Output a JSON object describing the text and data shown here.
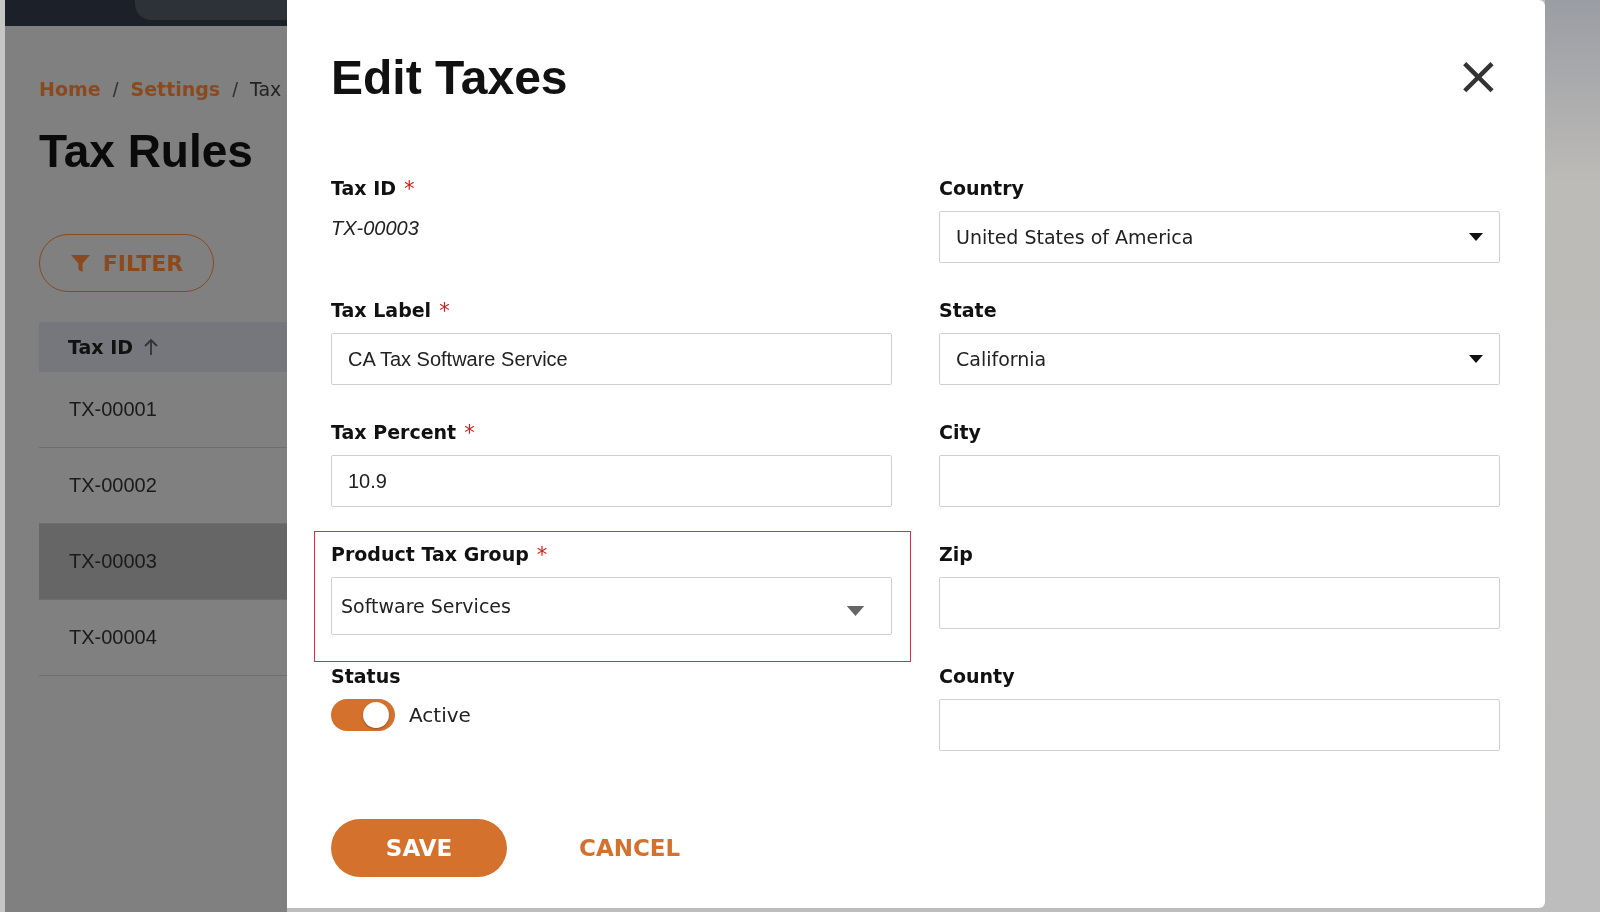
{
  "background_page": {
    "breadcrumb": [
      {
        "kind": "link",
        "label": "Home"
      },
      {
        "kind": "separator",
        "label": "/"
      },
      {
        "kind": "link",
        "label": "Settings"
      },
      {
        "kind": "separator",
        "label": "/"
      },
      {
        "kind": "current",
        "label": "Tax"
      }
    ],
    "title": "Tax Rules",
    "filter_button": "FILTER",
    "table": {
      "columns": [
        {
          "label": "Tax ID"
        }
      ],
      "rows": [
        {
          "cells": [
            "TX-00001"
          ],
          "selected": false
        },
        {
          "cells": [
            "TX-00002"
          ],
          "selected": false
        },
        {
          "cells": [
            "TX-00003"
          ],
          "selected": true
        },
        {
          "cells": [
            "TX-00004"
          ],
          "selected": false
        }
      ]
    }
  },
  "dialog": {
    "title": "Edit Taxes",
    "close": "×",
    "left": [
      {
        "kind": "readonly",
        "label": "Tax ID",
        "required_mark": "*",
        "value": "TX-00003"
      },
      {
        "kind": "input",
        "label": "Tax Label",
        "required_mark": "*",
        "value": "CA Tax Software Service"
      },
      {
        "kind": "input",
        "label": "Tax Percent",
        "required_mark": "*",
        "value": "10.9"
      },
      {
        "kind": "select",
        "label": "Product Tax Group",
        "required_mark": "*",
        "value": "Software Services",
        "highlighted": true
      },
      {
        "kind": "toggle",
        "label": "Status",
        "on": true,
        "value": "Active"
      }
    ],
    "right": [
      {
        "kind": "select",
        "label": "Country",
        "value": "United States of America"
      },
      {
        "kind": "select",
        "label": "State",
        "value": "California"
      },
      {
        "kind": "input",
        "label": "City"
      },
      {
        "kind": "input",
        "label": "Zip"
      },
      {
        "kind": "input",
        "label": "County"
      }
    ],
    "buttons": [
      {
        "kind": "primary",
        "label": "SAVE"
      },
      {
        "kind": "text",
        "label": "CANCEL"
      }
    ]
  }
}
